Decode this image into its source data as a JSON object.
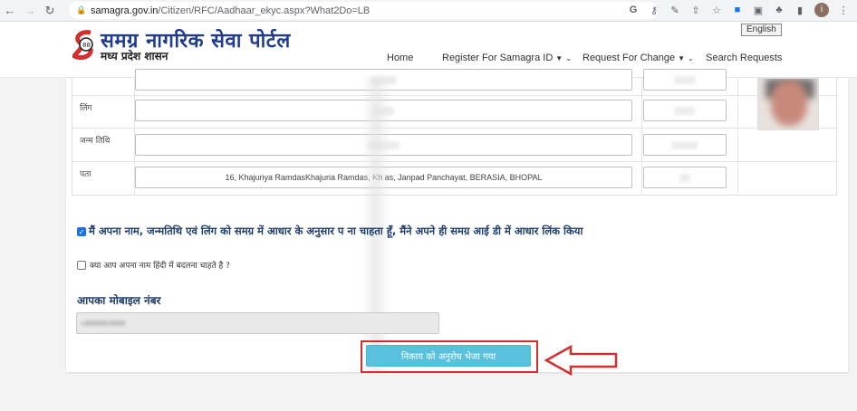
{
  "browser": {
    "url_host": "samagra.gov.in",
    "url_path": "/Citizen/RFC/Aadhaar_ekyc.aspx?What2Do=LB",
    "profile_initial": "i"
  },
  "header": {
    "logo_title": "समग्र नागरिक सेवा पोर्टल",
    "logo_subtitle": "मध्य प्रदेश शासन",
    "language_button": "English",
    "nav": [
      {
        "label": "Home"
      },
      {
        "label": "Register For Samagra ID"
      },
      {
        "label": "Request For Change"
      },
      {
        "label": "Search Requests"
      }
    ]
  },
  "form": {
    "rows": [
      {
        "label": ""
      },
      {
        "label": "लिंग"
      },
      {
        "label": "जन्म तिथि"
      },
      {
        "label": "पता"
      }
    ],
    "address_value": "16, Khajuriya RamdasKhajuria Ramdas, Kh                 as, Janpad Panchayat, BERASIA, BHOPAL",
    "consent_text": "मैं अपना नाम, जन्मतिथि एवं लिंग को समग्र में आधार के अनुसार प              ना चाहता हूँ, मैंने अपने ही समग्र आई डी में आधार लिंक किया",
    "hindi_name_question": "क्या आप अपना नाम हिंदी में बदलना चाहते है ?",
    "mobile_label": "आपका मोबाइल नंबर",
    "mobile_value": "+8888804888",
    "submit_label": "निकाय को अनुरोध भेजा गया"
  }
}
